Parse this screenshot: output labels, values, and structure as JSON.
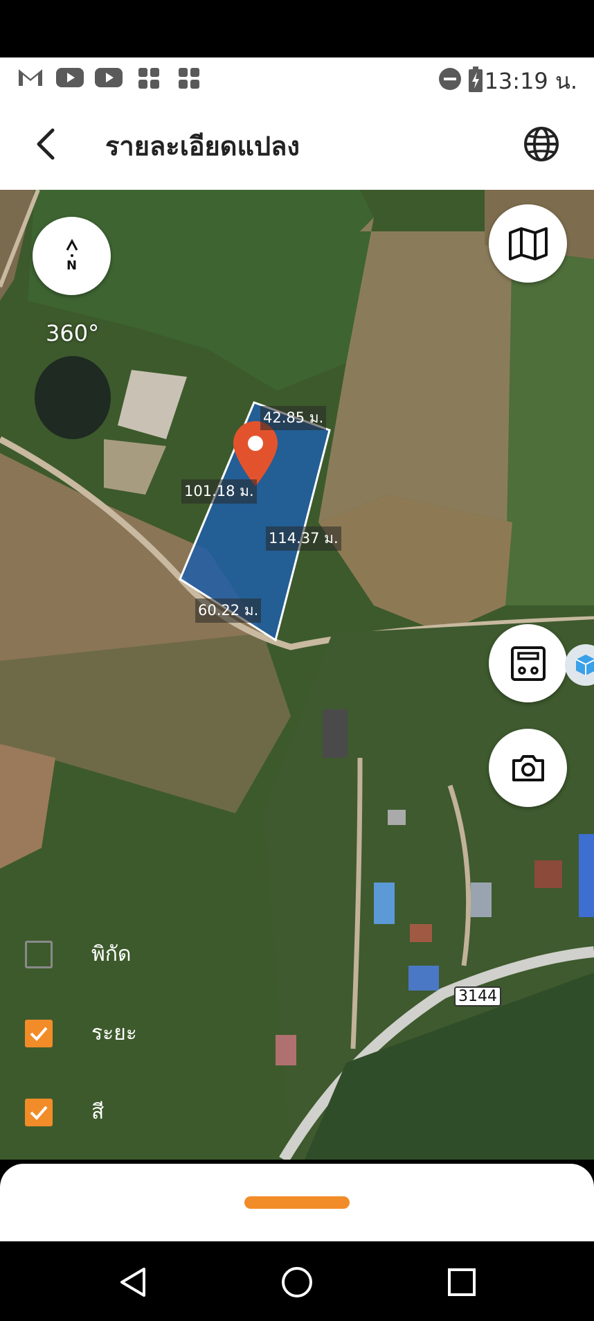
{
  "status_bar": {
    "time": "13:19 น.",
    "icons": [
      "gmail-icon",
      "youtube-icon",
      "youtube-icon",
      "app-grid-icon",
      "app-grid-icon",
      "do-not-disturb-icon",
      "battery-charging-icon"
    ]
  },
  "header": {
    "title": "รายละเอียดแปลง",
    "back_icon": "chevron-left-icon",
    "language_icon": "globe-icon"
  },
  "map": {
    "compass_label": "N",
    "compass_angle": "360°",
    "dimensions": {
      "top": "42.85 ม.",
      "left": "101.18 ม.",
      "right": "114.37 ม.",
      "bottom": "60.22 ม."
    },
    "road_number": "3144",
    "parcel_color": "#1f5fa8",
    "pin_color": "#e2532d"
  },
  "layers": [
    {
      "label": "พิกัด",
      "checked": false
    },
    {
      "label": "ระยะ",
      "checked": true
    },
    {
      "label": "สี",
      "checked": true
    }
  ],
  "accent_color": "#f28c28",
  "fabs": [
    "map-layers-icon",
    "calculator-icon",
    "camera-icon"
  ]
}
